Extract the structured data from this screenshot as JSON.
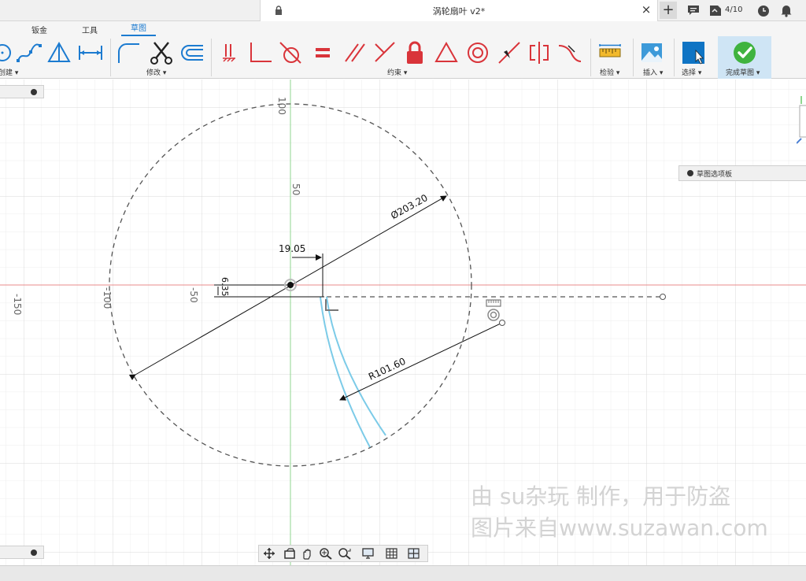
{
  "window": {
    "doc_title": "涡轮扇叶 v2*",
    "close_symbol": "×",
    "new_tab_symbol": "+",
    "jobs_count": "4/10"
  },
  "ribbon": {
    "tabs": [
      "钣金",
      "工具",
      "草图"
    ],
    "active_tab": "草图",
    "groups": {
      "create": "创建 ▾",
      "modify": "修改 ▾",
      "constraints": "约束 ▾",
      "inspect": "检验 ▾",
      "insert": "插入 ▾",
      "select": "选择 ▾",
      "finish": "完成草图 ▾"
    }
  },
  "colors": {
    "accent": "#1c7bd0",
    "constraint_red": "#d9343a",
    "finish_green": "#3fb33f",
    "sketch_curve": "#7ccbe8",
    "x_axis": "#e88b8b",
    "y_axis": "#8fd68f"
  },
  "panels": {
    "sketch_palette": "草图选项板"
  },
  "canvas": {
    "axis_labels": {
      "y100": "100",
      "y50": "50",
      "xm150": "-150",
      "xm100": "-100",
      "xm50": "-50"
    },
    "dimensions": {
      "diameter": "Ø203.20",
      "horizontal_offset": "19.05",
      "vertical_offset": "6.35",
      "radius": "R101.60"
    }
  },
  "watermark": {
    "line1": "由 su杂玩 制作，用于防盗",
    "line2": "图片来自www.suzawan.com"
  },
  "icons": [
    "lock-icon",
    "comment-icon",
    "jobs-icon",
    "clock-icon",
    "bell-icon",
    "orbit-icon",
    "pan-icon",
    "zoom-icon",
    "display-icon",
    "grid-icon",
    "viewport-icon"
  ]
}
